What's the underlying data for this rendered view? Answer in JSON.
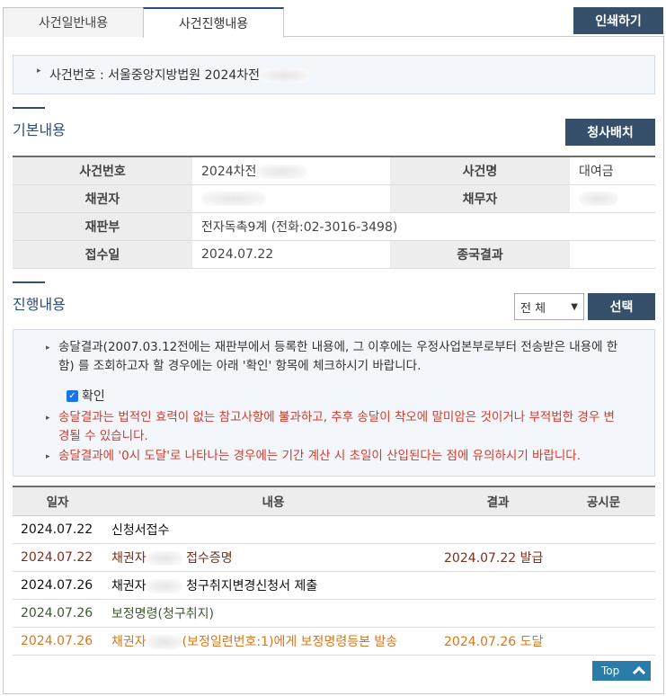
{
  "tabs": [
    "사건일반내용",
    "사건진행내용"
  ],
  "print_label": "인쇄하기",
  "case_line": "사건번호 : 서울중앙지방법원 2024차전",
  "basic": {
    "title": "기본내용",
    "button": "청사배치",
    "rows": [
      {
        "l1": "사건번호",
        "v1": "2024차전",
        "l2": "사건명",
        "v2": "대여금"
      },
      {
        "l1": "채권자",
        "v1": "",
        "l2": "채무자",
        "v2": ""
      },
      {
        "l1": "재판부",
        "v1": "전자독촉9계 (전화:02-3016-3498)",
        "l2": "",
        "v2": ""
      },
      {
        "l1": "접수일",
        "v1": "2024.07.22",
        "l2": "종국결과",
        "v2": ""
      }
    ]
  },
  "progress": {
    "title": "진행내용",
    "filter": "전 체",
    "select_button": "선택",
    "notice1": "송달결과(2007.03.12전에는 재판부에서 등록한 내용에, 그 이후에는 우정사업본부로부터 전송받은 내용에 한함) 를 조회하고자 할 경우에는 아래 '확인' 항목에 체크하시기 바랍니다.",
    "check_label": "확인",
    "notice2": "송달결과는 법적인 효력이 없는 참고사항에 불과하고, 추후 송달이 착오에 말미암은 것이거나 부적법한 경우 변경될 수 있습니다.",
    "notice3": "송달결과에 '0시 도달'로 나타나는 경우에는 기간 계산 시 초일이 산입된다는 점에 유의하시기 바랍니다.",
    "headers": [
      "일자",
      "내용",
      "결과",
      "공시문"
    ],
    "rows": [
      {
        "date": "2024.07.22",
        "pre": "신청서접수",
        "post": "",
        "result": ""
      },
      {
        "date": "2024.07.22",
        "pre": "채권자",
        "post": "접수증명",
        "result": "2024.07.22 발급"
      },
      {
        "date": "2024.07.26",
        "pre": "채권자",
        "post": "청구취지변경신청서 제출",
        "result": ""
      },
      {
        "date": "2024.07.26",
        "pre": "보정명령(청구취지)",
        "post": "",
        "result": ""
      },
      {
        "date": "2024.07.26",
        "pre": "채권자",
        "post": "(보정일련번호:1)에게 보정명령등본 발송",
        "result": "2024.07.26 도달"
      }
    ]
  },
  "top_label": "Top"
}
